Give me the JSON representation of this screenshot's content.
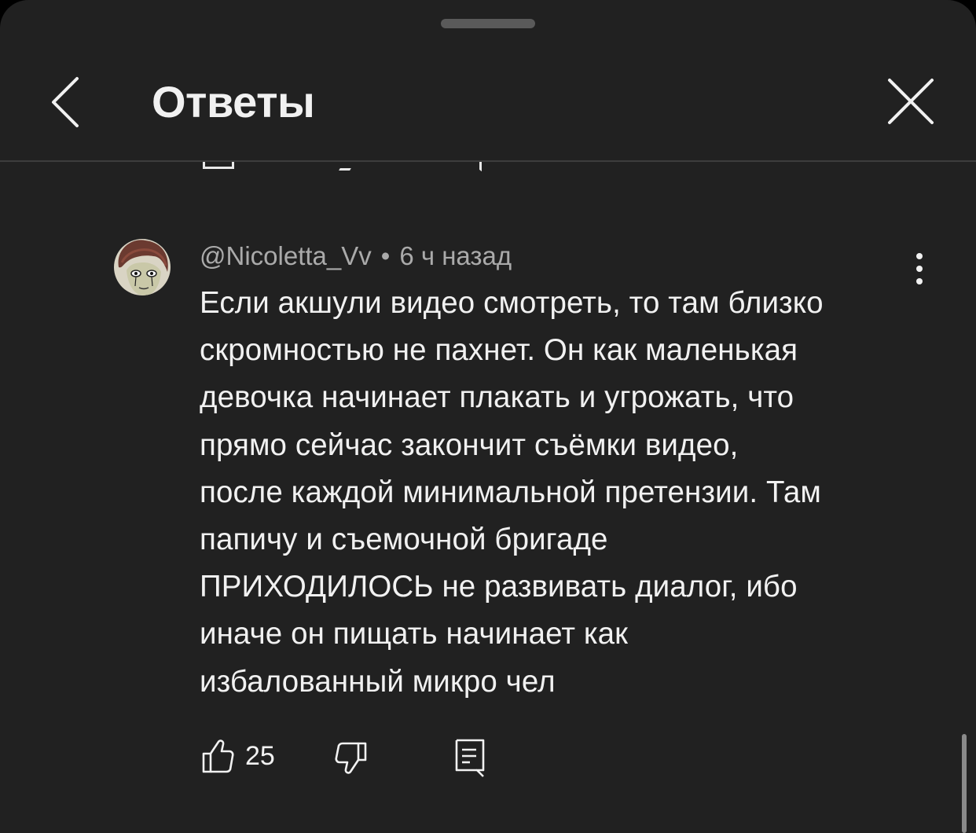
{
  "header": {
    "title": "Ответы",
    "back_icon": "chevron-left-icon",
    "close_icon": "close-icon"
  },
  "comment": {
    "author": "@Nicoletta_Vv",
    "separator": "•",
    "timestamp": "6 ч назад",
    "text": "Если акшули видео смотреть, то там близко\nскромностью не пахнет. Он как маленькая\nдевочка начинает плакать и угрожать, что\nпрямо сейчас закончит съёмки видео,\nпосле каждой минимальной претензии. Там\nпапичу и съемочной бригаде\nПРИХОДИЛОСЬ не развивать диалог, ибо\nиначе он пищать начинает как\nизбалованный микро чел",
    "like_count": "25",
    "icons": {
      "like": "thumbs-up-icon",
      "dislike": "thumbs-down-icon",
      "reply": "reply-icon",
      "more": "more-vertical-icon"
    }
  },
  "colors": {
    "background": "#212121",
    "text_primary": "#f1f1f1",
    "text_secondary": "#aaaaaa"
  }
}
